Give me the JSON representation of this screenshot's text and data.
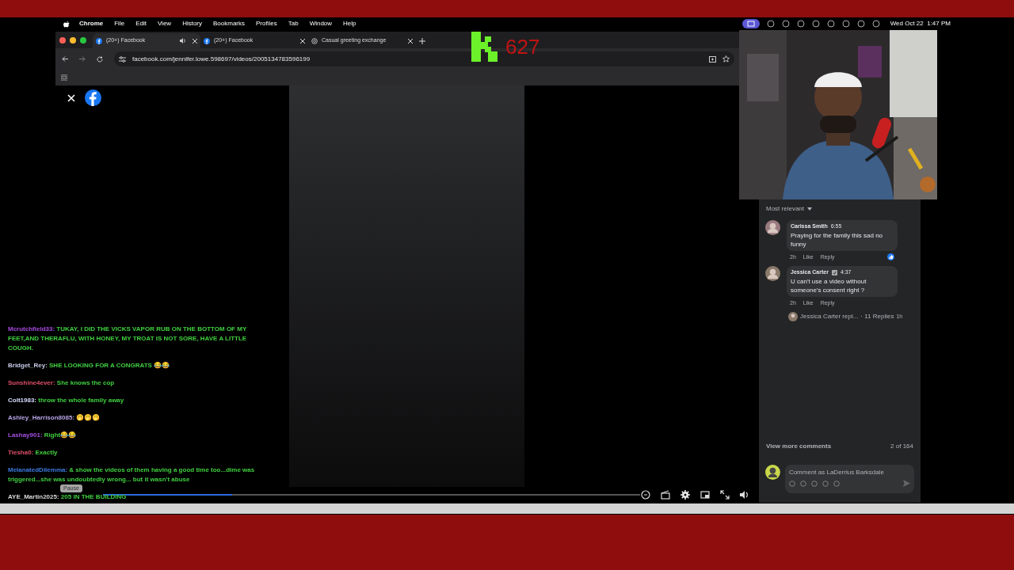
{
  "menu_bar": {
    "app": "Chrome",
    "menus": [
      "File",
      "Edit",
      "View",
      "History",
      "Bookmarks",
      "Profiles",
      "Tab",
      "Window",
      "Help"
    ],
    "clock": "Wed Oct 22  1:47 PM"
  },
  "browser": {
    "tabs": [
      {
        "title": "(20+) Facebook",
        "kind": "facebook",
        "selected": true,
        "audio": true
      },
      {
        "title": "(20+) Facebook",
        "kind": "facebook",
        "selected": false,
        "audio": false
      },
      {
        "title": "Casual greeting exchange",
        "kind": "chat",
        "selected": false,
        "audio": false
      }
    ],
    "url": "facebook.com/jennifer.lowe.598697/videos/2005134783596199"
  },
  "counter": {
    "value": "627"
  },
  "comments": {
    "sort": "Most relevant",
    "items": [
      {
        "author": "Carissa Smith",
        "time": "6:55",
        "text": "Praying for the family this sad no funny",
        "age": "2h",
        "like": "Like",
        "reply": "Reply",
        "liked": true,
        "badge": false
      },
      {
        "author": "Jessica Carter",
        "time": "4:37",
        "text": "U can't use a video without someone's consent right ?",
        "age": "2h",
        "like": "Like",
        "reply": "Reply",
        "liked": false,
        "badge": true
      }
    ],
    "reply_summary": {
      "text": "Jessica Carter repl...",
      "count": "· 11 Replies",
      "age": "1h"
    },
    "view_more": "View more comments",
    "count": "2 of 164",
    "composer": {
      "placeholder": "Comment as LaDerrius Barksdale"
    }
  },
  "player": {
    "level": 0.24,
    "tooltip": "Pause"
  },
  "chat": [
    {
      "user": "Mcrutchfield33:",
      "color": "#a64be0",
      "text": "TUKAY, I DID THE VICKS VAPOR RUB ON THE BOTTOM OF MY FEET,AND THERAFLU, WITH HONEY, MY TROAT IS NOT SORE, HAVE A LITTLE COUGH."
    },
    {
      "user": "Bridget_Rey:",
      "color": "#c8cce8",
      "text": "SHE LOOKING FOR A CONGRATS 😂😂"
    },
    {
      "user": "Sunshine4ever:",
      "color": "#e0506a",
      "text": "She knows the cop"
    },
    {
      "user": "Colt1983:",
      "color": "#d6dcff",
      "text": "throw the whole family away"
    },
    {
      "user": "Ashley_Harrison8085:",
      "color": "#b8a4e6",
      "text": "🤭🤭🤭"
    },
    {
      "user": "Lashay901:",
      "color": "#a54ee0",
      "text": "Right😂😂"
    },
    {
      "user": "Tiesha0:",
      "color": "#e0506a",
      "text": "Exactly"
    },
    {
      "user": "MelanatedDilemma:",
      "color": "#3b7be0",
      "text": "& show the videos of them having a good time too...dime was triggered...she was undoubtedly wrong... but it wasn't abuse"
    },
    {
      "user": "AYE_Martin2025:",
      "color": "#d8d8d8",
      "text": "205 IN THE BUILDING"
    }
  ]
}
